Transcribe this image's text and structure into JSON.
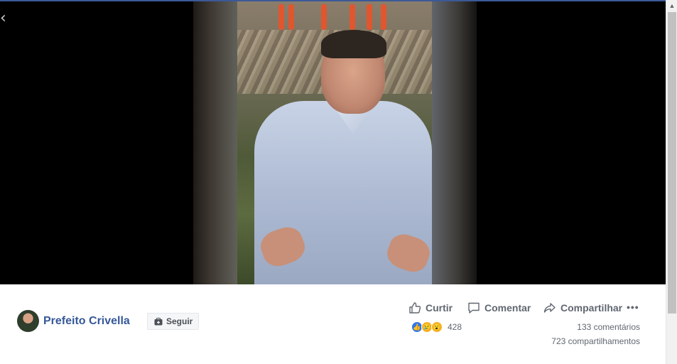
{
  "post": {
    "page_name": "Prefeito Crivella",
    "follow_label": "Seguir"
  },
  "actions": {
    "like_label": "Curtir",
    "comment_label": "Comentar",
    "share_label": "Compartilhar",
    "more_label": "•••"
  },
  "stats": {
    "reaction_count": "428",
    "comments": "133 comentários",
    "shares": "723 compartilhamentos"
  },
  "icons": {
    "back": "chevron-left-icon",
    "reactions": [
      "like-reaction-icon",
      "sad-reaction-icon",
      "wow-reaction-icon"
    ]
  },
  "colors": {
    "brand": "#365899",
    "like_blue": "#3578e5",
    "text_muted": "#606770",
    "video_bg": "#000000"
  }
}
